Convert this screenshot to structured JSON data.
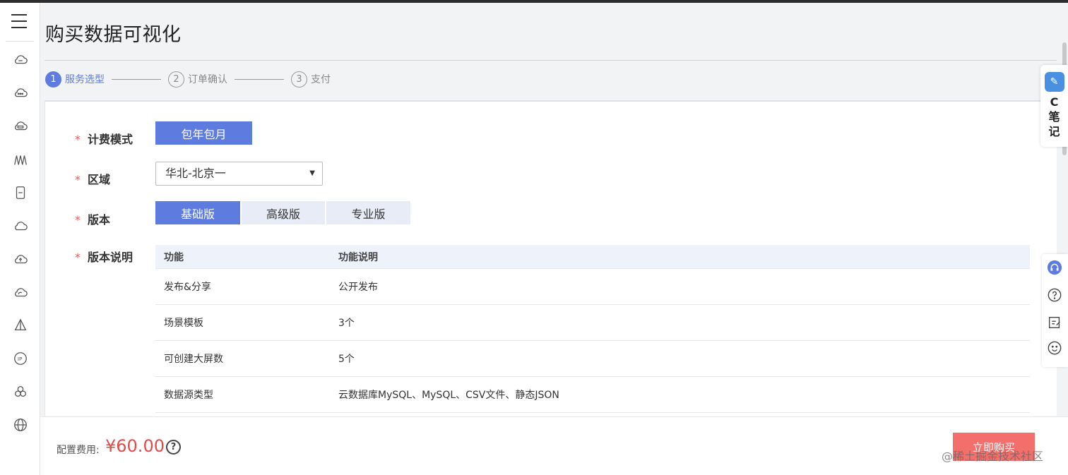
{
  "page": {
    "title": "购买数据可视化"
  },
  "steps": [
    {
      "num": "1",
      "label": "服务选型"
    },
    {
      "num": "2",
      "label": "订单确认"
    },
    {
      "num": "3",
      "label": "支付"
    }
  ],
  "form": {
    "billing_label": "计费模式",
    "billing_value": "包年包月",
    "region_label": "区域",
    "region_value": "华北-北京一",
    "version_label": "版本",
    "versions": [
      "基础版",
      "高级版",
      "专业版"
    ],
    "desc_label": "版本说明",
    "required_mark": "*"
  },
  "table": {
    "headers": [
      "功能",
      "功能说明"
    ],
    "rows": [
      [
        "发布&分享",
        "公开发布"
      ],
      [
        "场景模板",
        "3个"
      ],
      [
        "可创建大屏数",
        "5个"
      ],
      [
        "数据源类型",
        "云数据库MySQL、MySQL、CSV文件、静态JSON"
      ]
    ]
  },
  "footer": {
    "fee_label": "配置费用:",
    "fee_price": "¥60.00",
    "help_glyph": "?",
    "buy_label": "立即购买"
  },
  "widgets": {
    "note_text": "C笔记",
    "watermark": "@稀土掘金技术社区"
  },
  "colors": {
    "primary": "#5e7ce0",
    "price": "#e34a4a",
    "buy_button": "#f36f6c",
    "required": "#e55555"
  },
  "sidebar_icons": [
    "cloud-server-icon",
    "cloud-dots-icon",
    "cloud-storage-icon",
    "waves-icon",
    "phone-icon",
    "cloud-icon",
    "cloud-upload-icon",
    "cloud-sync-icon",
    "pyramid-icon",
    "ip-icon",
    "cluster-icon",
    "globe-icon"
  ]
}
